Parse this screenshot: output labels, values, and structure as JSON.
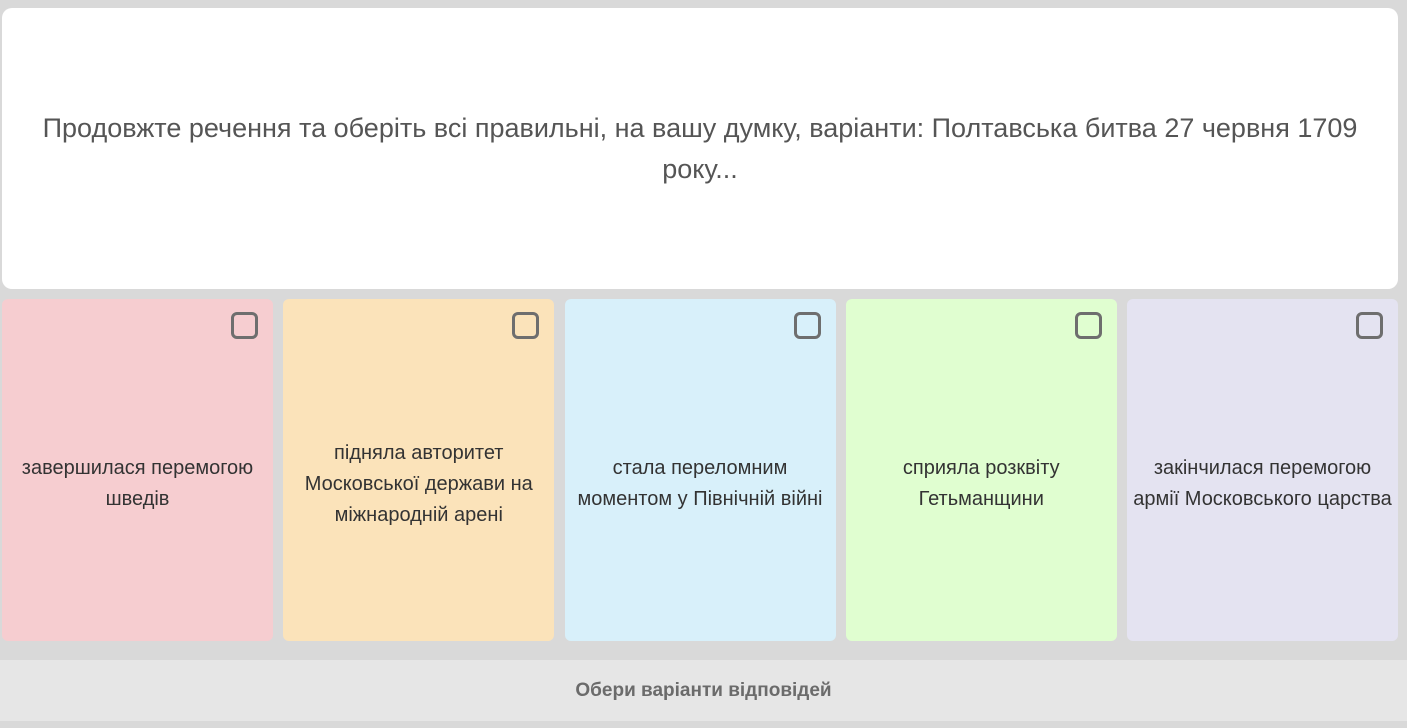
{
  "question": {
    "text": "Продовжте речення та оберіть всі правильні, на вашу думку, варіанти: Полтавська битва 27 червня 1709 року..."
  },
  "options": [
    {
      "text": "завершилася перемогою шведів",
      "color": "#f6cdd0",
      "checked": false
    },
    {
      "text": "підняла авторитет Московської держави на міжнародній арені",
      "color": "#fbe3ba",
      "checked": false
    },
    {
      "text": "стала переломним моментом у Північній війні",
      "color": "#d8f0fa",
      "checked": false
    },
    {
      "text": "сприяла розквіту Гетьманщини",
      "color": "#e0fed0",
      "checked": false
    },
    {
      "text": "закінчилася перемогою армії Московського царства",
      "color": "#e4e3f1",
      "checked": false
    }
  ],
  "footer": {
    "submit_label": "Обери варіанти відповідей"
  }
}
